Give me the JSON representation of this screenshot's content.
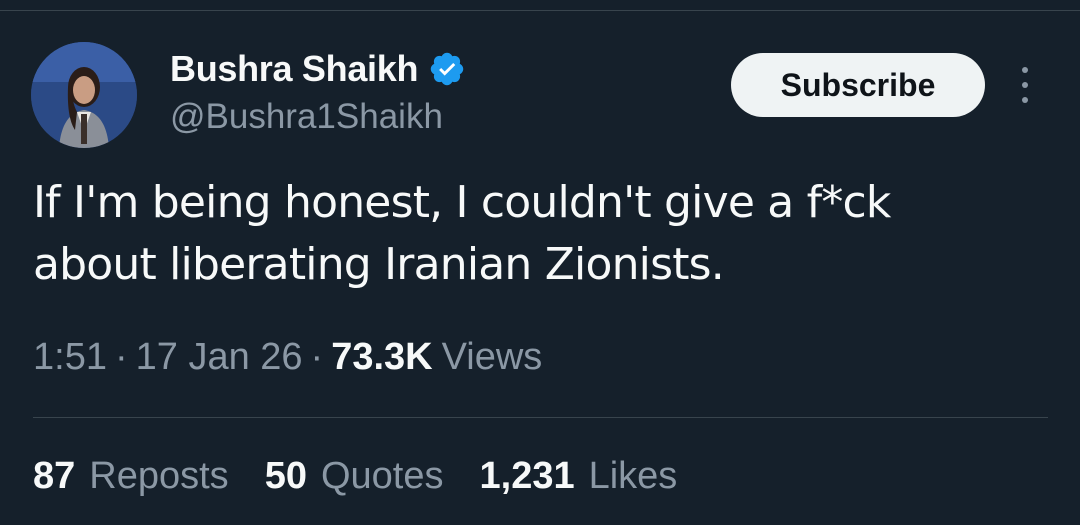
{
  "tweet": {
    "author": {
      "display_name": "Bushra Shaikh",
      "handle": "@Bushra1Shaikh",
      "verified": true,
      "verified_color": "#1d9bf0"
    },
    "subscribe_label": "Subscribe",
    "more_icon": "more-vertical-icon",
    "text_lines": [
      "If I'm being honest, I couldn't give a f*ck",
      "about liberating Iranian Zionists."
    ],
    "time": "1:51",
    "separator": "·",
    "date": "17 Jan 26",
    "views_count": "73.3K",
    "views_label": "Views",
    "stats": {
      "reposts": {
        "count": "87",
        "label": "Reposts"
      },
      "quotes": {
        "count": "50",
        "label": "Quotes"
      },
      "likes": {
        "count": "1,231",
        "label": "Likes"
      }
    }
  },
  "colors": {
    "background": "#15202b",
    "text_primary": "#f7f9f9",
    "text_secondary": "#8b98a5",
    "divider": "#38444d",
    "button_bg": "#eff3f4"
  }
}
